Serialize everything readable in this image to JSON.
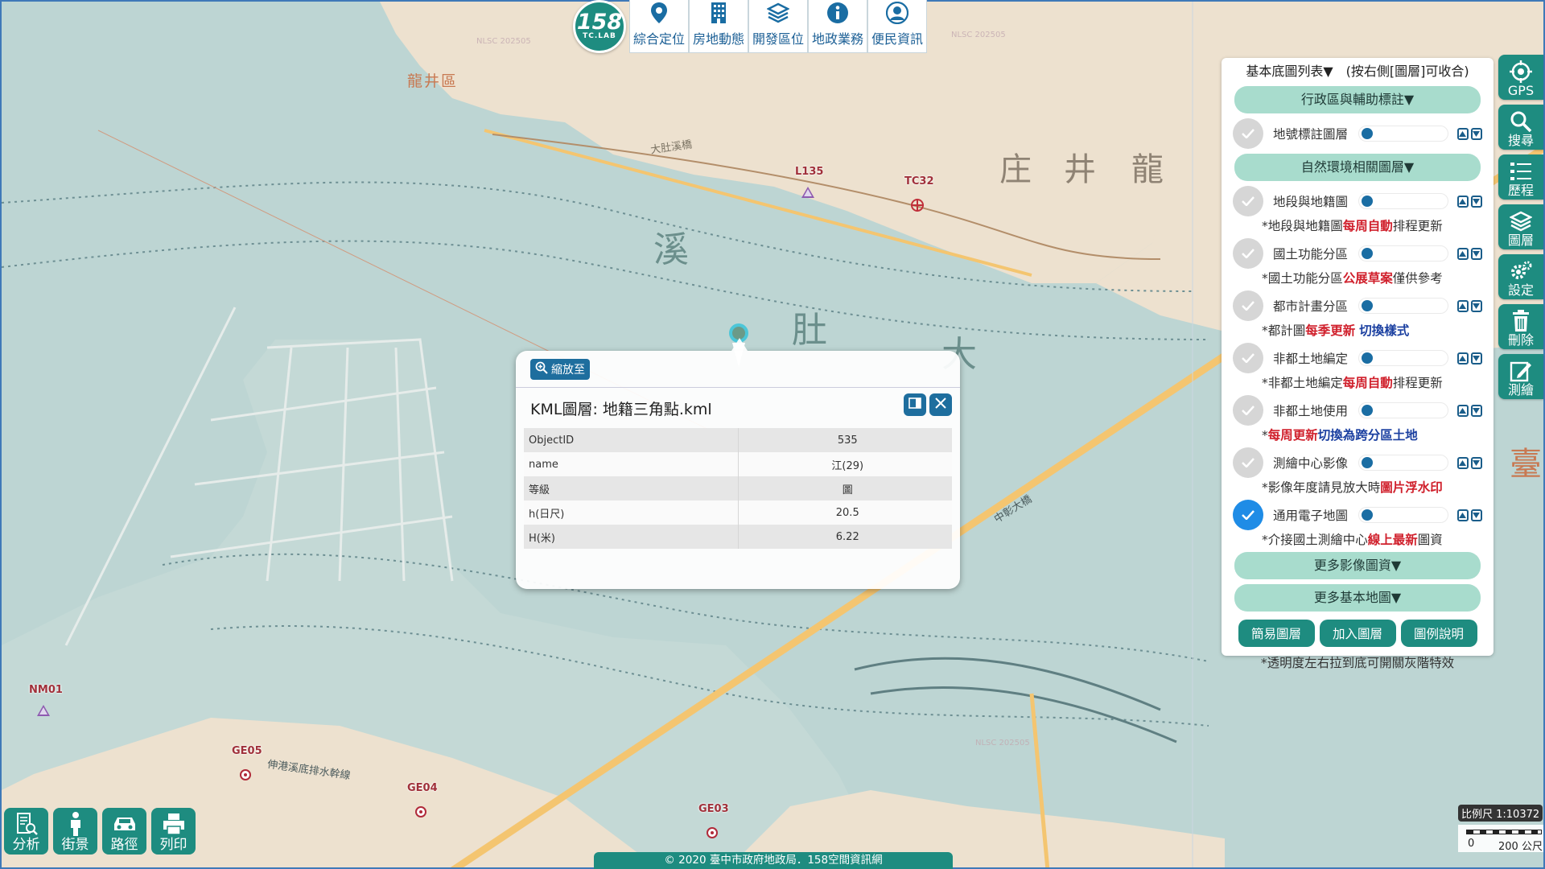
{
  "map": {
    "district_label": "龍井區",
    "big_chars": [
      "溪",
      "肚",
      "大"
    ],
    "land_chars": [
      "庄",
      "井",
      "龍",
      "臺"
    ],
    "road_labels": [
      "大肚溪橋",
      "中彰大橋",
      "伸港溪底排水幹線"
    ],
    "watermark": "NLSC 202505",
    "control_points": [
      {
        "name": "L135",
        "type": "triangle"
      },
      {
        "name": "TC32",
        "type": "cross"
      },
      {
        "name": "NM01",
        "type": "triangle"
      },
      {
        "name": "GE05",
        "type": "circle"
      },
      {
        "name": "GE04",
        "type": "circle"
      },
      {
        "name": "GE03",
        "type": "circle"
      }
    ]
  },
  "logo": {
    "number": "158",
    "sub": "TC.LAB"
  },
  "top_toolbar": [
    {
      "label": "綜合定位",
      "icon": "map-pin-icon"
    },
    {
      "label": "房地動態",
      "icon": "building-icon"
    },
    {
      "label": "開發區位",
      "icon": "layers-icon"
    },
    {
      "label": "地政業務",
      "icon": "info-icon"
    },
    {
      "label": "便民資訊",
      "icon": "user-icon"
    }
  ],
  "right_toolbar": [
    {
      "label": "GPS",
      "icon": "gps-icon"
    },
    {
      "label": "搜尋",
      "icon": "search-icon"
    },
    {
      "label": "歷程",
      "icon": "history-icon"
    },
    {
      "label": "圖層",
      "icon": "layers-icon"
    },
    {
      "label": "設定",
      "icon": "gear-icon"
    },
    {
      "label": "刪除",
      "icon": "trash-icon"
    },
    {
      "label": "測繪",
      "icon": "edit-icon"
    }
  ],
  "layer_panel": {
    "header": "基本底圖列表▼　(按右側[圖層]可收合)",
    "section_admin": "行政區與輔助標註▼",
    "layer_parcel_label": "地號標註圖層",
    "section_nature": "自然環境相關圖層▼",
    "layers": [
      {
        "name": "地段與地籍圖",
        "checked": false,
        "note": [
          {
            "t": "*地段與地籍圖"
          },
          {
            "t": "每周自動",
            "c": "red"
          },
          {
            "t": "排程更新"
          }
        ]
      },
      {
        "name": "國土功能分區",
        "checked": false,
        "note": [
          {
            "t": "*國土功能分區"
          },
          {
            "t": "公展草案",
            "c": "red"
          },
          {
            "t": "僅供參考"
          }
        ]
      },
      {
        "name": "都市計畫分區",
        "checked": false,
        "note": [
          {
            "t": "*都計圖"
          },
          {
            "t": "每季更新",
            "c": "red"
          },
          {
            "t": " "
          },
          {
            "t": "切換樣式",
            "c": "blue"
          }
        ]
      },
      {
        "name": "非都土地編定",
        "checked": false,
        "note": [
          {
            "t": "*非都土地編定"
          },
          {
            "t": "每周自動",
            "c": "red"
          },
          {
            "t": "排程更新"
          }
        ]
      },
      {
        "name": "非都土地使用",
        "checked": false,
        "note": [
          {
            "t": "*"
          },
          {
            "t": "每周更新",
            "c": "red"
          },
          {
            "t": "切換為跨分區土地",
            "c": "blue"
          }
        ]
      },
      {
        "name": "測繪中心影像",
        "checked": false,
        "note": [
          {
            "t": "*影像年度請見放大時"
          },
          {
            "t": "圖片浮水印",
            "c": "red"
          }
        ]
      },
      {
        "name": "通用電子地圖",
        "checked": true,
        "note": [
          {
            "t": "*介接國土測繪中心"
          },
          {
            "t": "線上最新",
            "c": "red"
          },
          {
            "t": "圖資"
          }
        ]
      }
    ],
    "section_more_images": "更多影像圖資▼",
    "section_more_basemaps": "更多基本地圖▼",
    "actions": [
      "簡易圖層",
      "加入圖層",
      "圖例說明"
    ],
    "footer": "*透明度左右拉到底可開關灰階特效"
  },
  "popup": {
    "zoom_label": "縮放至",
    "title": "KML圖層: 地籍三角點.kml",
    "rows": [
      {
        "key": "ObjectID",
        "value": "535"
      },
      {
        "key": "name",
        "value": "江(29)"
      },
      {
        "key": "等級",
        "value": "圖"
      },
      {
        "key": "h(日尺)",
        "value": "20.5"
      },
      {
        "key": "H(米)",
        "value": "6.22"
      }
    ]
  },
  "bottom_tools": [
    {
      "label": "分析",
      "icon": "analysis-icon"
    },
    {
      "label": "街景",
      "icon": "person-icon"
    },
    {
      "label": "路徑",
      "icon": "car-icon"
    },
    {
      "label": "列印",
      "icon": "printer-icon"
    }
  ],
  "copyright": "© 2020 臺中市政府地政局．158空間資訊網",
  "scale": {
    "ratio": "比例尺 1:10372",
    "zero": "0",
    "distance": "200 公尺"
  }
}
